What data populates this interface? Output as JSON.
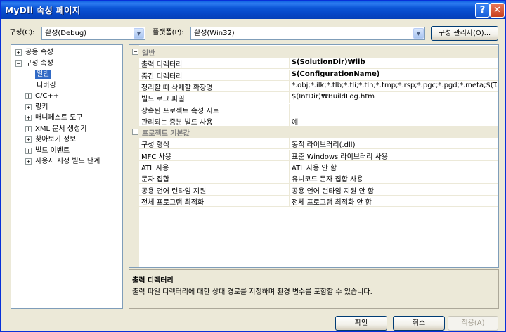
{
  "window": {
    "title": "MyDll 속성 페이지",
    "help_glyph": "?",
    "close_glyph": "✕"
  },
  "toolbar": {
    "config_label": "구성(C):",
    "config_value": "활성(Debug)",
    "platform_label": "플랫폼(P):",
    "platform_value": "활성(Win32)",
    "config_manager_button": "구성 관리자(O)..."
  },
  "tree": {
    "items": [
      {
        "label": "공용 속성",
        "expander": "+"
      },
      {
        "label": "구성 속성",
        "expander": "−"
      },
      {
        "label": "일반",
        "expander": ""
      },
      {
        "label": "디버깅",
        "expander": ""
      },
      {
        "label": "C/C++",
        "expander": "+"
      },
      {
        "label": "링커",
        "expander": "+"
      },
      {
        "label": "매니페스트 도구",
        "expander": "+"
      },
      {
        "label": "XML 문서 생성기",
        "expander": "+"
      },
      {
        "label": "찾아보기 정보",
        "expander": "+"
      },
      {
        "label": "빌드 이벤트",
        "expander": "+"
      },
      {
        "label": "사용자 지정 빌드 단계",
        "expander": "+"
      }
    ],
    "selected": "일반"
  },
  "grid": {
    "categories": [
      {
        "title": "일반",
        "expander": "−",
        "rows": [
          {
            "name": "출력 디렉터리",
            "value": "$(SolutionDir)₩lib",
            "bold": true
          },
          {
            "name": "중간 디렉터리",
            "value": "$(ConfigurationName)",
            "bold": true
          },
          {
            "name": "정리할 때 삭제할 확장명",
            "value": "*.obj;*.ilk;*.tlb;*.tli;*.tlh;*.tmp;*.rsp;*.pgc;*.pgd;*.meta;$(TargetPat",
            "bold": false
          },
          {
            "name": "빌드 로그 파일",
            "value": "$(IntDir)₩BuildLog.htm",
            "bold": false
          },
          {
            "name": "상속된 프로젝트 속성 시트",
            "value": "",
            "bold": false
          },
          {
            "name": "관리되는 증분 빌드 사용",
            "value": "예",
            "bold": false
          }
        ]
      },
      {
        "title": "프로젝트 기본값",
        "expander": "−",
        "rows": [
          {
            "name": "구성 형식",
            "value": "동적 라이브러리(.dll)",
            "bold": false
          },
          {
            "name": "MFC 사용",
            "value": "표준 Windows 라이브러리 사용",
            "bold": false
          },
          {
            "name": "ATL 사용",
            "value": "ATL 사용 안 함",
            "bold": false
          },
          {
            "name": "문자 집합",
            "value": "유니코드 문자 집합 사용",
            "bold": false
          },
          {
            "name": "공용 언어 런타임 지원",
            "value": "공용 언어 런타임 지원 안 함",
            "bold": false
          },
          {
            "name": "전체 프로그램 최적화",
            "value": "전체 프로그램 최적화 안 함",
            "bold": false
          }
        ]
      }
    ]
  },
  "description": {
    "title": "출력 디렉터리",
    "text": "출력 파일 디렉터리에 대한 상대 경로를 지정하며 환경 변수를 포함할 수 있습니다."
  },
  "buttons": {
    "ok": "확인",
    "cancel": "취소",
    "apply": "적용(A)"
  }
}
